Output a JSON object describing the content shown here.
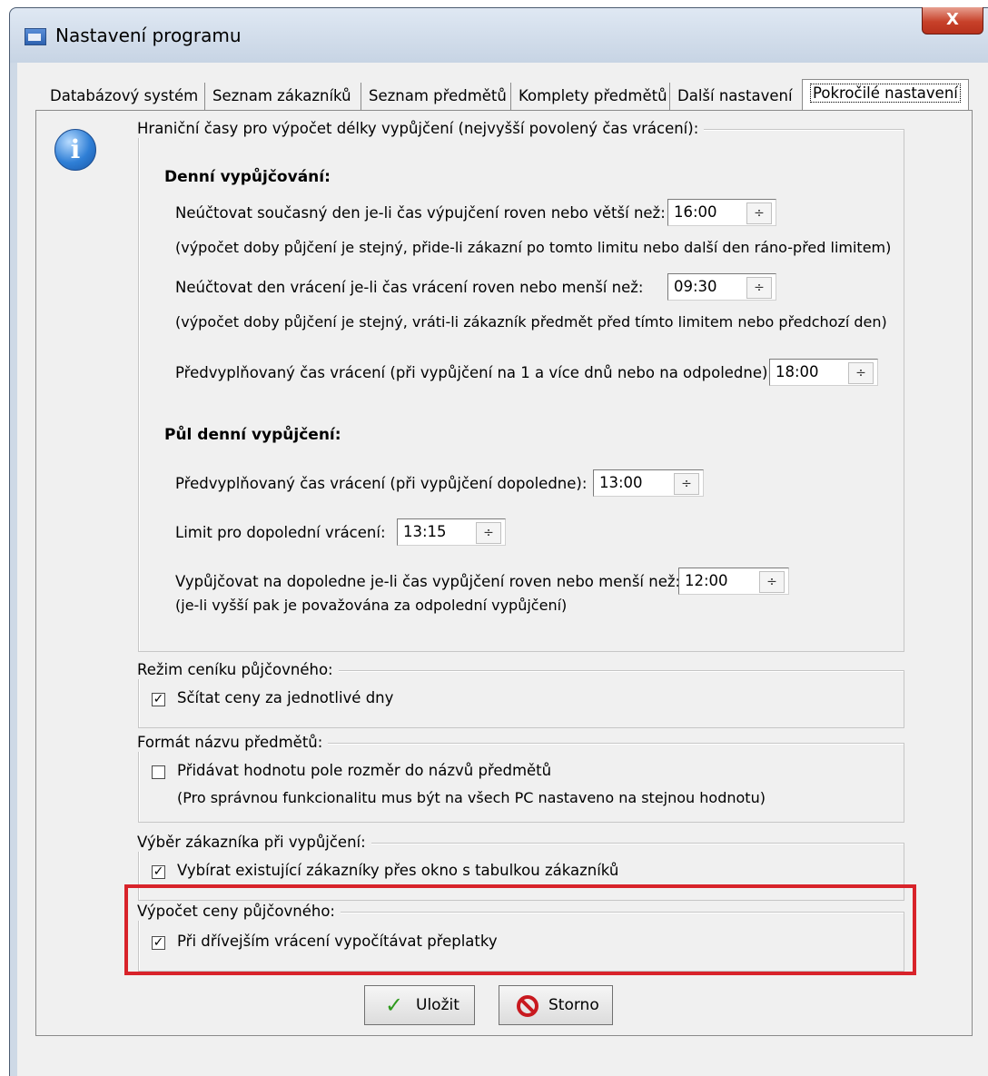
{
  "window": {
    "title": "Nastavení programu",
    "close_label": "X"
  },
  "tabs": [
    {
      "label": "Databázový systém"
    },
    {
      "label": "Seznam zákazníků"
    },
    {
      "label": "Seznam předmětů"
    },
    {
      "label": "Komplety předmětů"
    },
    {
      "label": "Další nastavení"
    },
    {
      "label": "Pokročilé nastavení",
      "active": true
    }
  ],
  "info_icon": {
    "glyph": "i"
  },
  "group_times": {
    "legend": "Hraniční časy pro výpočet délky vypůjčení (nejvyšší povolený čas vrácení):",
    "daily_heading": "Denní vypůjčování:",
    "row1_label": "Neúčtovat současný den je-li čas výpujčení roven nebo větší než:",
    "row1_value": "16:00",
    "row1_note": "(výpočet doby půjčení je stejný, přide-li zákazní po tomto limitu nebo další den ráno-před limitem)",
    "row2_label": "Neúčtovat den vrácení je-li čas vrácení roven nebo menší než:",
    "row2_value": "09:30",
    "row2_note": "(výpočet doby půjčení je stejný, vráti-li zákazník předmět před tímto limitem nebo předchozí den)",
    "row3_label": "Předvyplňovaný čas vrácení (při vypůjčení na 1 a více dnů nebo na odpoledne):",
    "row3_value": "18:00",
    "half_heading": "Půl denní vypůjčení:",
    "row4_label": "Předvyplňovaný čas vrácení (při vypůjčení dopoledne):",
    "row4_value": "13:00",
    "row5_label": "Limit pro dopolední vrácení:",
    "row5_value": "13:15",
    "row6_label": "Vypůjčovat na dopoledne je-li čas vypůjčení roven nebo menší než:",
    "row6_value": "12:00",
    "row6_note": "(je-li vyšší pak je považována za odpolední vypůjčení)"
  },
  "group_pricing_mode": {
    "legend": "Režim ceníku půjčovného:",
    "checkbox_label": "Sčítat ceny za jednotlivé dny",
    "checked": true
  },
  "group_name_format": {
    "legend": "Formát názvu předmětů:",
    "checkbox_label": "Přidávat hodnotu pole rozměr do názvů předmětů",
    "checked": false,
    "note": "(Pro správnou funkcionalitu mus být na všech PC nastaveno na stejnou hodnotu)"
  },
  "group_customer_select": {
    "legend": "Výběr zákazníka při vypůjčení:",
    "checkbox_label": "Vybírat existující zákazníky přes okno s tabulkou zákazníků",
    "checked": true
  },
  "group_price_calc": {
    "legend": "Výpočet ceny půjčovného:",
    "checkbox_label": "Při dřívejším vrácení vypočítávat přeplatky",
    "checked": true
  },
  "spin_arrows": "÷",
  "check_mark": "✓",
  "buttons": {
    "save_label": "Uložit",
    "cancel_label": "Storno"
  },
  "colors": {
    "highlight": "#d8232a",
    "save_icon": "#2f9a1e",
    "cancel_icon": "#c8191f"
  }
}
